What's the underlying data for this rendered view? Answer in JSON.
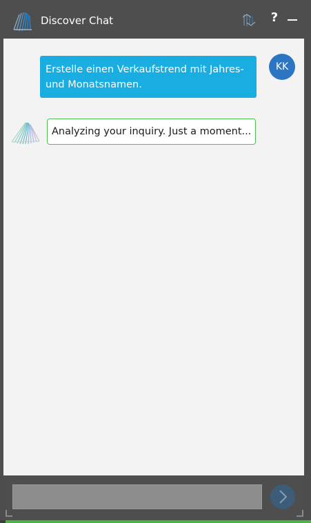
{
  "window": {
    "title": "Discover Chat",
    "help_label": "?"
  },
  "messages": {
    "user": {
      "text": "Erstelle einen Verkaufstrend mit Jahres- und Monatsnamen.",
      "avatar_initials": "KK"
    },
    "bot": {
      "text": "Analyzing your inquiry. Just a moment..."
    }
  },
  "composer": {
    "value": "",
    "placeholder": ""
  },
  "colors": {
    "titlebar": "#4e4e4e",
    "chat_background": "#f3f3f3",
    "user_bubble": "#1aade2",
    "avatar": "#2b75c2",
    "bot_border": "#4fbf52",
    "send_button": "#3d5c78"
  },
  "icons": {
    "app": "discover-logo-icon",
    "sync": "sync-icon",
    "minimize": "minimize-icon",
    "send": "chevron-right-icon",
    "bot": "bot-logo-icon"
  }
}
